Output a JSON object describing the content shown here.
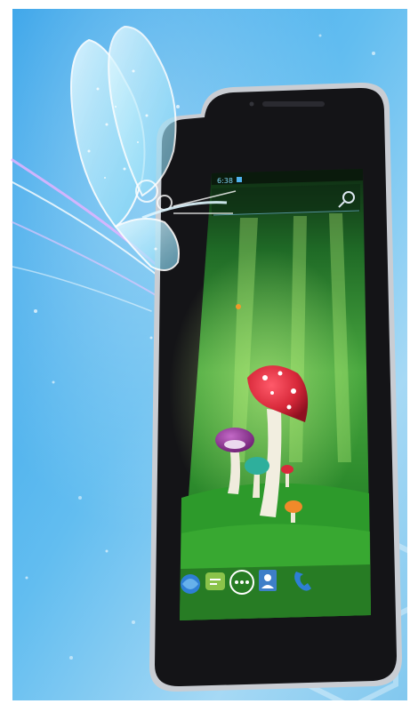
{
  "status_bar": {
    "time": "6:38"
  },
  "search_bar": {
    "icon": "search-icon"
  },
  "dock": {
    "items": [
      {
        "icon": "browser-icon"
      },
      {
        "icon": "messaging-icon"
      },
      {
        "icon": "app-drawer-icon"
      },
      {
        "icon": "contacts-icon"
      },
      {
        "icon": "phone-icon"
      }
    ]
  },
  "colors": {
    "background_blue": "#4FB3EE",
    "bezel": "#151518",
    "wallpaper_green": "#2E8F34",
    "mushroom_red": "#D8293A",
    "mushroom_purple": "#8C2F8E"
  }
}
